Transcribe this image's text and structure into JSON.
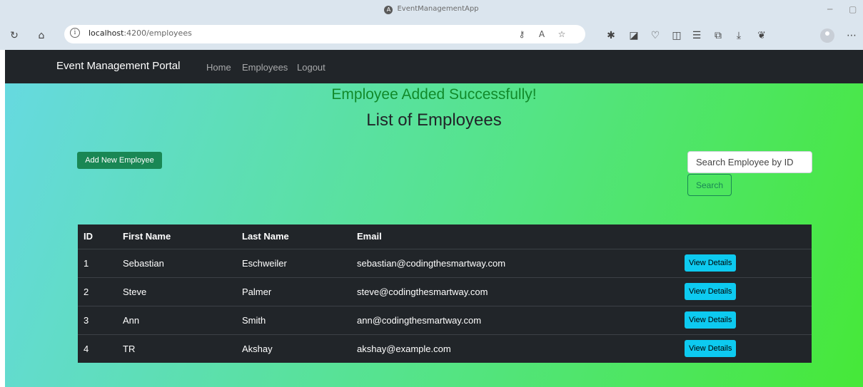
{
  "browser": {
    "tab_title": "EventManagementApp",
    "url_host": "localhost",
    "url_path": ":4200/employees"
  },
  "navbar": {
    "brand": "Event Management Portal",
    "links": [
      "Home",
      "Employees",
      "Logout"
    ]
  },
  "page": {
    "success_message": "Employee Added Successfully!",
    "heading": "List of Employees",
    "add_button_label": "Add New Employee",
    "search_placeholder": "Search Employee by ID",
    "search_button_label": "Search"
  },
  "table": {
    "columns": [
      "ID",
      "First Name",
      "Last Name",
      "Email",
      ""
    ],
    "view_button_label": "View Details",
    "rows": [
      {
        "id": "1",
        "first_name": "Sebastian",
        "last_name": "Eschweiler",
        "email": "sebastian@codingthesmartway.com"
      },
      {
        "id": "2",
        "first_name": "Steve",
        "last_name": "Palmer",
        "email": "steve@codingthesmartway.com"
      },
      {
        "id": "3",
        "first_name": "Ann",
        "last_name": "Smith",
        "email": "ann@codingthesmartway.com"
      },
      {
        "id": "4",
        "first_name": "TR",
        "last_name": "Akshay",
        "email": "akshay@example.com"
      }
    ]
  },
  "colors": {
    "navbar_bg": "#212529",
    "success_text": "#118a2a",
    "add_button": "#198754",
    "view_button": "#0dcaf0",
    "gradient_start": "#66d9e0",
    "gradient_end": "#46e838"
  }
}
